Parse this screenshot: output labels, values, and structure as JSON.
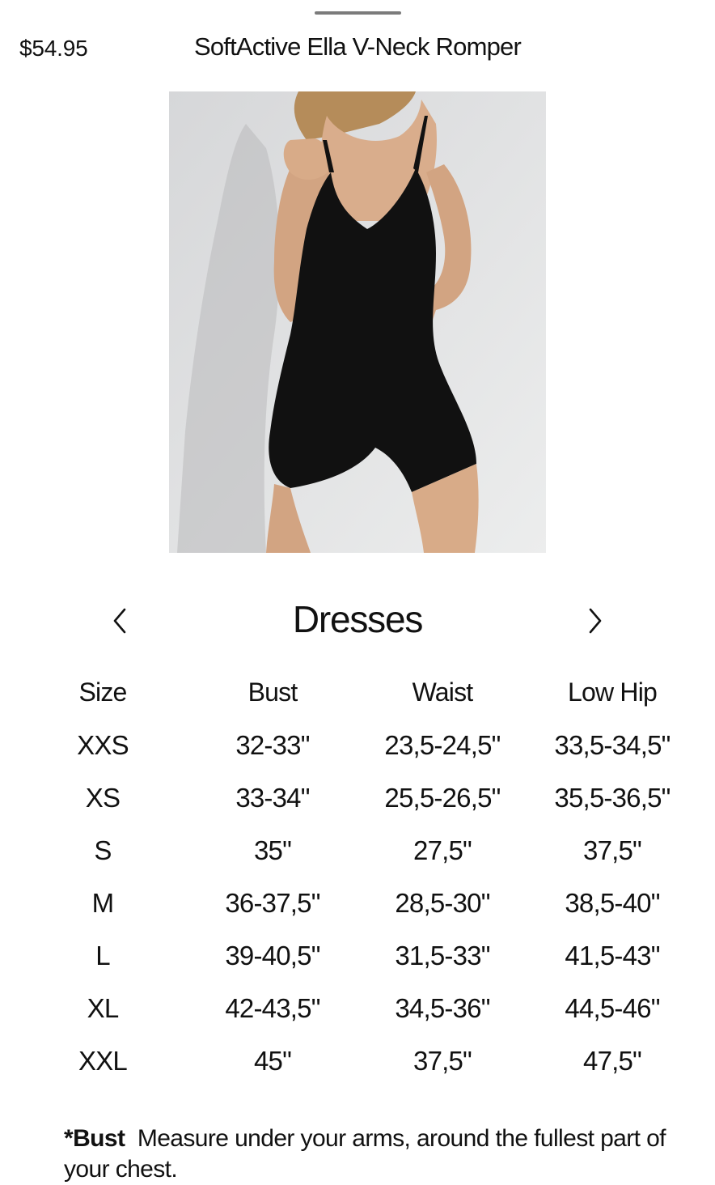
{
  "sheet": {
    "price": "$54.95",
    "product_title": "SoftActive Ella V-Neck Romper"
  },
  "product_image": {
    "icon": "romper-photo",
    "background": "#e6e6e6",
    "garment_color": "#111111"
  },
  "size_chart": {
    "category": "Dresses",
    "prev_icon": "chevron-left-icon",
    "next_icon": "chevron-right-icon",
    "columns": [
      "Size",
      "Bust",
      "Waist",
      "Low Hip"
    ],
    "rows": [
      [
        "XXS",
        "32-33\"",
        "23,5-24,5\"",
        "33,5-34,5\""
      ],
      [
        "XS",
        "33-34\"",
        "25,5-26,5\"",
        "35,5-36,5\""
      ],
      [
        "S",
        "35\"",
        "27,5\"",
        "37,5\""
      ],
      [
        "M",
        "36-37,5\"",
        "28,5-30\"",
        "38,5-40\""
      ],
      [
        "L",
        "39-40,5\"",
        "31,5-33\"",
        "41,5-43\""
      ],
      [
        "XL",
        "42-43,5\"",
        "34,5-36\"",
        "44,5-46\""
      ],
      [
        "XXL",
        "45\"",
        "37,5\"",
        "47,5\""
      ]
    ]
  },
  "footnote": {
    "term": "*Bust",
    "text": "Measure under your arms, around the fullest part of your chest."
  }
}
